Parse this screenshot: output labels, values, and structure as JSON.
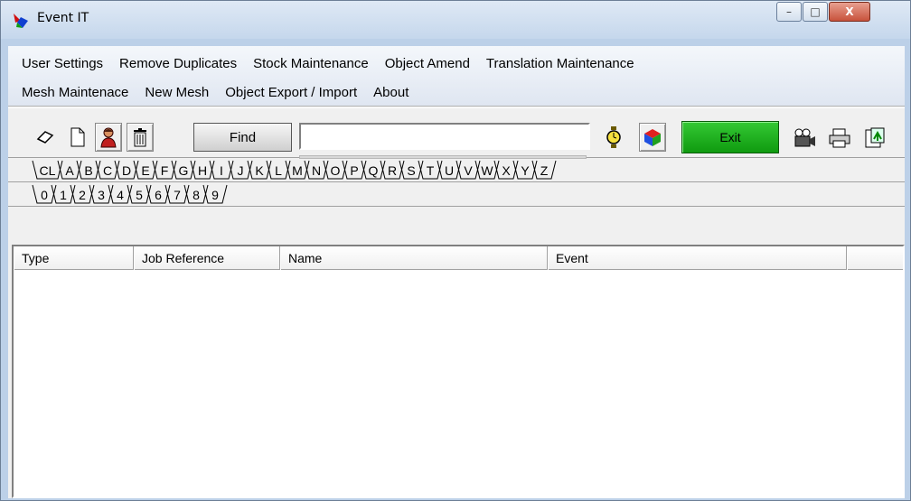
{
  "window": {
    "title": "Event IT",
    "controls": {
      "minimize": "–",
      "maximize": "□",
      "close": "X"
    }
  },
  "menu": {
    "row1": [
      "User Settings",
      "Remove Duplicates",
      "Stock Maintenance",
      "Object Amend",
      "Translation Maintenance"
    ],
    "row2": [
      "Mesh Maintenace",
      "New Mesh",
      "Object Export / Import",
      "About"
    ]
  },
  "toolbar": {
    "find_label": "Find",
    "search_value": "",
    "exit_label": "Exit",
    "icons": [
      "eraser-icon",
      "new-document-icon",
      "person-icon",
      "trash-icon",
      "stopwatch-icon",
      "color-cube-icon",
      "camera-icon",
      "printer-icon",
      "export-icon"
    ],
    "colors": {
      "exit": "#1fb01f",
      "window": "#bcd0e8",
      "menubar": "#e3eaf4"
    }
  },
  "tabs": {
    "row1": [
      "CL",
      "A",
      "B",
      "C",
      "D",
      "E",
      "F",
      "G",
      "H",
      "I",
      "J",
      "K",
      "L",
      "M",
      "N",
      "O",
      "P",
      "Q",
      "R",
      "S",
      "T",
      "U",
      "V",
      "W",
      "X",
      "Y",
      "Z"
    ],
    "row2": [
      "0",
      "1",
      "2",
      "3",
      "4",
      "5",
      "6",
      "7",
      "8",
      "9"
    ]
  },
  "list": {
    "columns": [
      "Type",
      "Job Reference",
      "Name",
      "Event",
      ""
    ],
    "rows": []
  }
}
